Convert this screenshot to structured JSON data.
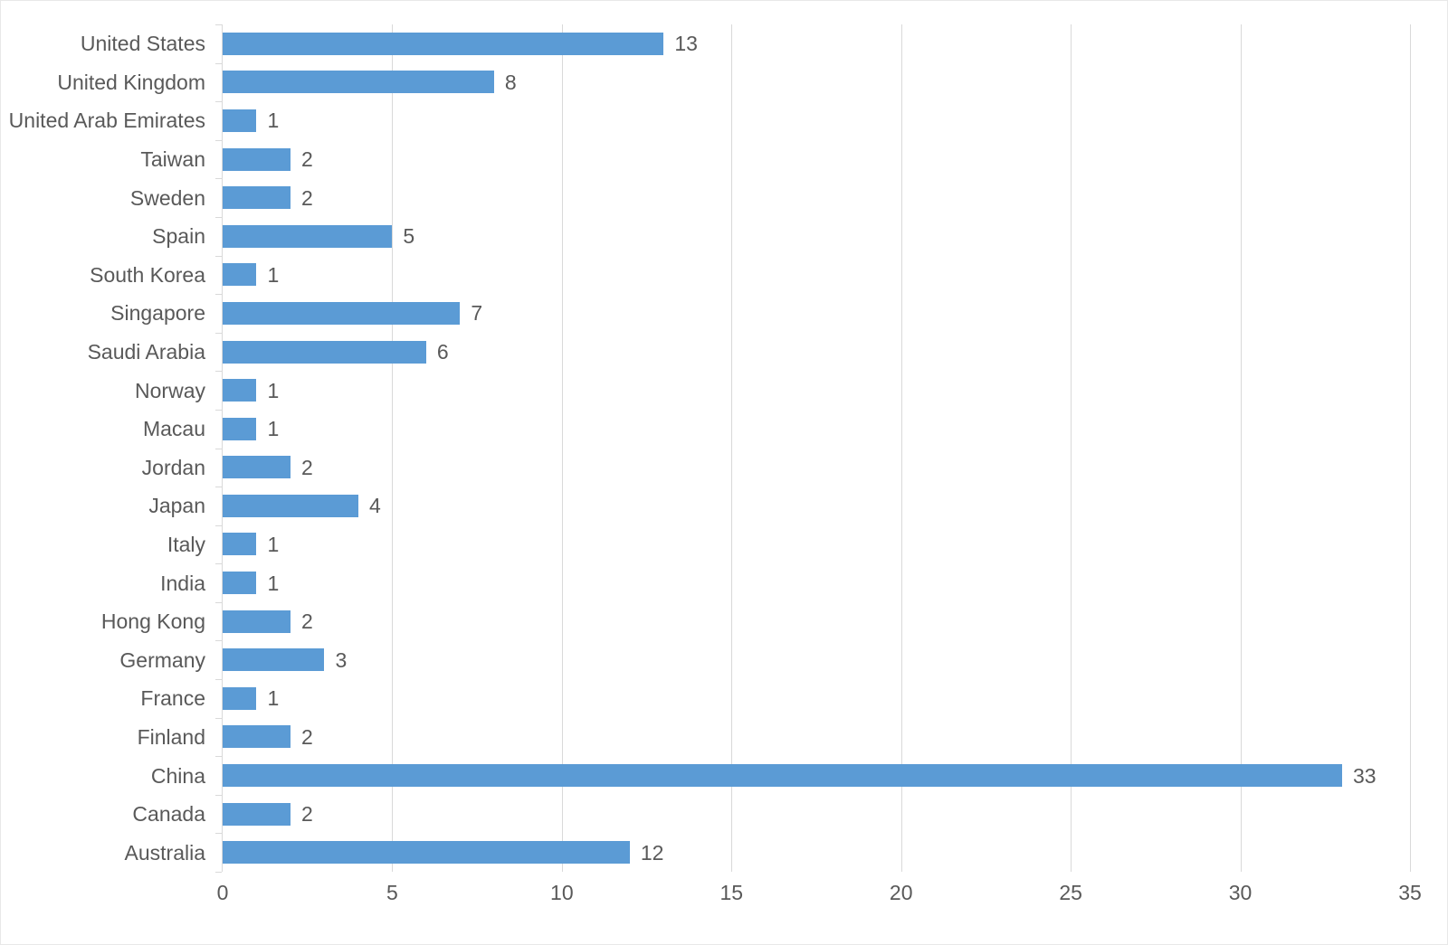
{
  "chart_data": {
    "type": "bar",
    "orientation": "horizontal",
    "title": "",
    "subtitle": "",
    "xlabel": "",
    "ylabel": "",
    "xlim": [
      0,
      35
    ],
    "x_ticks": [
      0,
      5,
      10,
      15,
      20,
      25,
      30,
      35
    ],
    "x_tick_labels": [
      "0",
      "5",
      "10",
      "15",
      "20",
      "25",
      "30",
      "35"
    ],
    "grid": "vertical",
    "legend": "none",
    "bar_color": "#5b9bd5",
    "text_color": "#595959",
    "gridline_color": "#d9d9d9",
    "categories": [
      "United States",
      "United Kingdom",
      "United Arab Emirates",
      "Taiwan",
      "Sweden",
      "Spain",
      "South Korea",
      "Singapore",
      "Saudi Arabia",
      "Norway",
      "Macau",
      "Jordan",
      "Japan",
      "Italy",
      "India",
      "Hong Kong",
      "Germany",
      "France",
      "Finland",
      "China",
      "Canada",
      "Australia"
    ],
    "values": [
      13,
      8,
      1,
      2,
      2,
      5,
      1,
      7,
      6,
      1,
      1,
      2,
      4,
      1,
      1,
      2,
      3,
      1,
      2,
      33,
      2,
      12
    ],
    "data_labels": [
      "13",
      "8",
      "1",
      "2",
      "2",
      "5",
      "1",
      "7",
      "6",
      "1",
      "1",
      "2",
      "4",
      "1",
      "1",
      "2",
      "3",
      "1",
      "2",
      "33",
      "2",
      "12"
    ]
  }
}
